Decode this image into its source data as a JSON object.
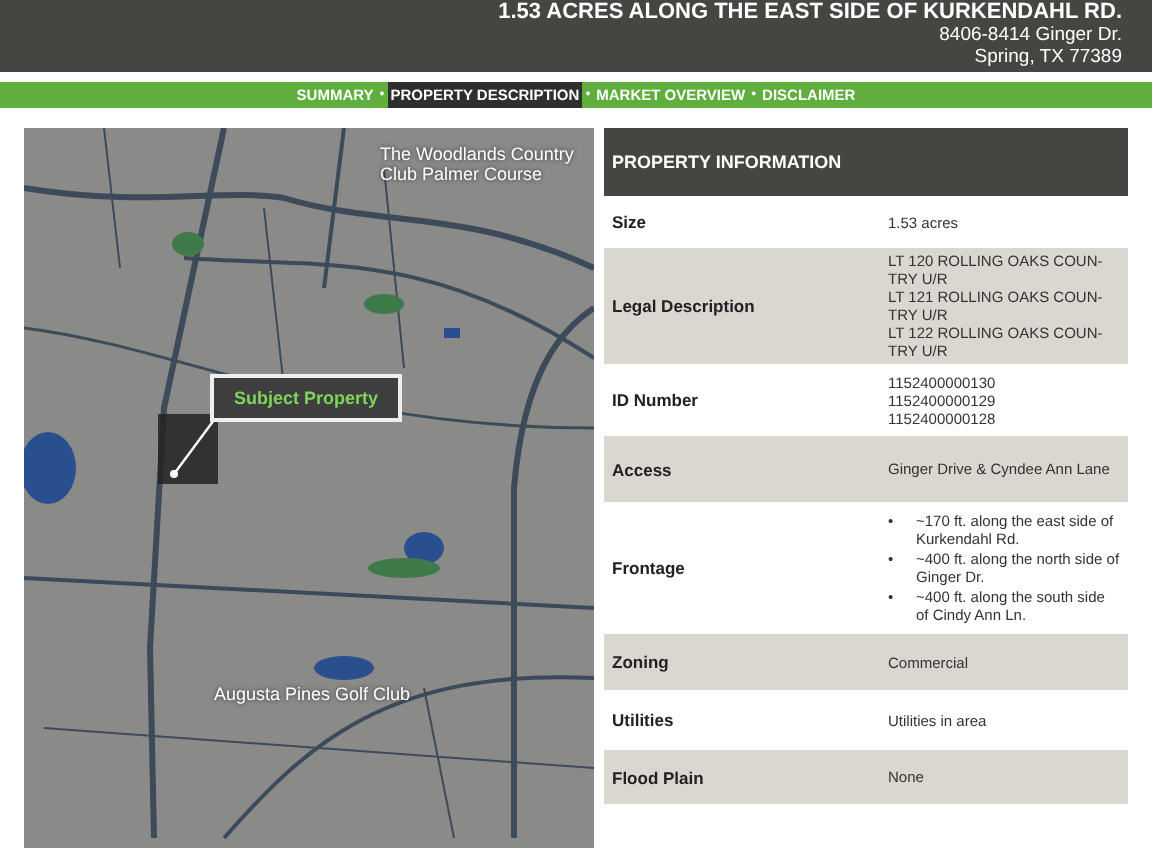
{
  "header": {
    "title": "1.53 ACRES ALONG THE EAST SIDE OF KURKENDAHL RD.",
    "address_lines": [
      "8406-8414 Ginger Dr.",
      "Spring, TX 77389"
    ]
  },
  "nav": [
    {
      "label": "SUMMARY",
      "selected": false
    },
    {
      "label": "PROPERTY DESCRIPTION",
      "selected": true
    },
    {
      "label": "MARKET OVERVIEW",
      "selected": false
    },
    {
      "label": "DISCLAIMER",
      "selected": false
    }
  ],
  "nav_separator": "•",
  "map": {
    "callout": "Subject Property",
    "places": [
      "The Woodlands Country Club Palmer Course",
      "Augusta Pines Golf Club"
    ]
  },
  "table": {
    "title": "PROPERTY INFORMATION",
    "rows": [
      {
        "label": "Size",
        "kind": "text",
        "values": [
          "1.53 acres"
        ]
      },
      {
        "label": "Legal Description",
        "kind": "text",
        "values": [
          "LT 120 ROLLING OAKS COUN-TRY U/R",
          "LT 121 ROLLING OAKS COUN-TRY U/R",
          "LT 122 ROLLING OAKS COUN-TRY U/R"
        ]
      },
      {
        "label": "ID Number",
        "kind": "text",
        "values": [
          "1152400000130",
          "1152400000129",
          "1152400000128"
        ]
      },
      {
        "label": "Access",
        "kind": "text",
        "values": [
          "Ginger Drive & Cyndee Ann Lane"
        ]
      },
      {
        "label": "Frontage",
        "kind": "bullets",
        "bullet": "•",
        "values": [
          "~170 ft. along the east side of Kurkendahl Rd.",
          "~400 ft. along the north side of Ginger Dr.",
          "~400 ft. along the south side of Cindy Ann Ln."
        ]
      },
      {
        "label": "Zoning",
        "kind": "text",
        "values": [
          "Commercial"
        ]
      },
      {
        "label": "Utilities",
        "kind": "text",
        "values": [
          "Utilities in area"
        ]
      },
      {
        "label": "Flood Plain",
        "kind": "text",
        "values": [
          "None"
        ]
      }
    ]
  }
}
